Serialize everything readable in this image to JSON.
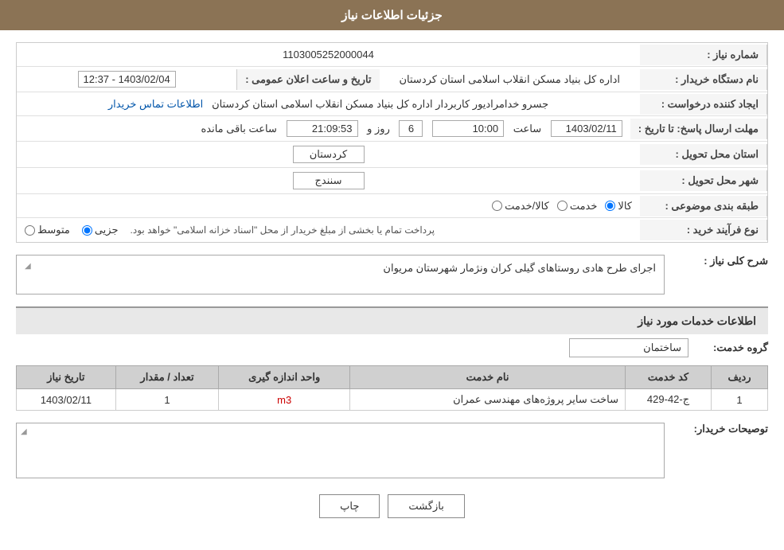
{
  "header": {
    "title": "جزئیات اطلاعات نیاز"
  },
  "info": {
    "shomara_niaz_label": "شماره نیاز :",
    "shomara_niaz_value": "1103005252000044",
    "nam_dastgah_label": "نام دستگاه خریدار :",
    "nam_dastgah_value": "اداره کل بنیاد مسکن انقلاب اسلامی استان کردستان",
    "ijad_konande_label": "ایجاد کننده درخواست :",
    "ijad_konande_value": "جسرو خدامرادیور کاربردار اداره کل بنیاد مسکن انقلاب اسلامی استان کردستان",
    "ijad_konande_link": "اطلاعات تماس خریدار",
    "mohlet_label": "مهلت ارسال پاسخ: تا تاریخ :",
    "tarikh_value": "1403/02/11",
    "saat_label": "ساعت",
    "saat_value": "10:00",
    "roz_label": "روز و",
    "roz_value": "6",
    "saat_mande_label": "ساعت باقی مانده",
    "saat_mande_value": "21:09:53",
    "elan_label": "تاریخ و ساعت اعلان عمومی :",
    "elan_value": "1403/02/04 - 12:37",
    "ostan_label": "استان محل تحویل :",
    "ostan_value": "کردستان",
    "shahr_label": "شهر محل تحویل :",
    "shahr_value": "سنندج",
    "tabaqe_label": "طبقه بندی موضوعی :",
    "tabaqe_kala": "کالا",
    "tabaqe_khedmat": "خدمت",
    "tabaqe_kala_khedmat": "کالا/خدمت",
    "nooe_farayand_label": "نوع فرآیند خرید :",
    "nooe_jozii": "جزیی",
    "nooe_motevaset": "متوسط",
    "nooe_desc": "پرداخت تمام یا بخشی از مبلغ خریدار از محل \"اسناد خزانه اسلامی\" خواهد بود."
  },
  "sharh_section": {
    "title": "شرح کلی نیاز :",
    "value": "اجرای طرح هادی روستاهای گیلی کران ونژمار شهرستان مریوان"
  },
  "khadamat_section": {
    "title": "اطلاعات خدمات مورد نیاز",
    "gorooh_label": "گروه خدمت:",
    "gorooh_value": "ساختمان"
  },
  "table": {
    "headers": [
      "ردیف",
      "کد خدمت",
      "نام خدمت",
      "واحد اندازه گیری",
      "تعداد / مقدار",
      "تاریخ نیاز"
    ],
    "rows": [
      {
        "radif": "1",
        "code": "ج-42-429",
        "name": "ساخت سایر پروژه‌های مهندسی عمران",
        "unit": "m3",
        "count": "1",
        "date": "1403/02/11"
      }
    ]
  },
  "tawzihat": {
    "label": "توصیحات خریدار:",
    "value": ""
  },
  "buttons": {
    "print_label": "چاپ",
    "back_label": "بازگشت"
  }
}
